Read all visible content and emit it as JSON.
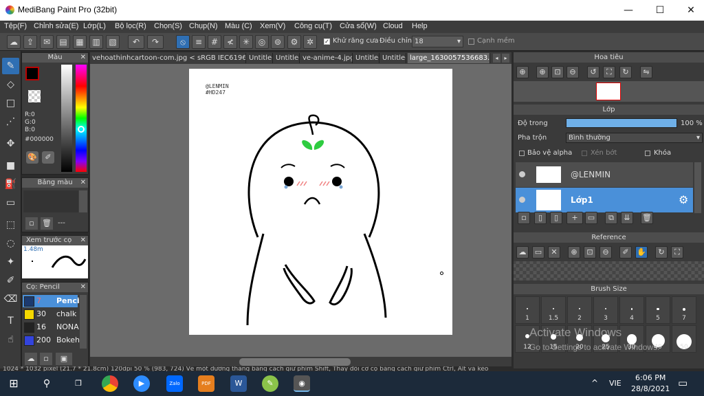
{
  "window": {
    "title": "MediBang Paint Pro (32bit)",
    "min_label": "—",
    "max_label": "☐",
    "close_label": "✕"
  },
  "menu": [
    "Tệp(F)",
    "Chỉnh sửa(E)",
    "Lớp(L)",
    "Bộ lọc(R)",
    "Chọn(S)",
    "Chụp(N)",
    "Màu (C)",
    "Xem(V)",
    "Công cụ(T)",
    "Cửa sổ(W)",
    "Cloud",
    "Help"
  ],
  "toolbar": {
    "antialias_label": "Khử răng cưa",
    "adjust_label": "Điều chỉnh",
    "adjust_value": "18",
    "snap_label": "Cạnh mềm"
  },
  "color_panel": {
    "title": "Màu",
    "r": "R:0",
    "g": "G:0",
    "b": "B:0",
    "hex": "#000000"
  },
  "palette_panel": {
    "title": "Bảng màu",
    "dashes": "---"
  },
  "preview_panel": {
    "title": "Xem trước cọ",
    "size": "1.48m"
  },
  "brush_panel": {
    "title": "Cọ: Pencil",
    "items": [
      {
        "size": "7",
        "name": "Pencil",
        "color": "#1c3a6e"
      },
      {
        "size": "30",
        "name": "chalk",
        "color": "#f5d800"
      },
      {
        "size": "16",
        "name": "NONA",
        "color": "#222222"
      },
      {
        "size": "200",
        "name": "Bokeh",
        "color": "#3344dd"
      }
    ]
  },
  "doc_tabs": [
    "vehoathinhcartoon-com.jpg < sRGB IEC61966-2.1 >",
    "Untitled",
    "Untitled",
    "ve-anime-4.jpg",
    "Untitled",
    "Untitled",
    "large_1630057536683.jpg"
  ],
  "canvas": {
    "signature_line1": "@LENMIN",
    "signature_line2": "#HD247"
  },
  "navigator": {
    "title": "Hoa tiêu"
  },
  "layers": {
    "title": "Lớp",
    "opacity_label": "Độ trong",
    "opacity_value": "100 %",
    "opacity_fraction": 1.0,
    "blend_label": "Pha trộn",
    "blend_value": "Bình thường",
    "protect_alpha": "Bảo vệ alpha",
    "clipping": "Xén bớt",
    "lock": "Khóa",
    "items": [
      {
        "name": "@LENMIN",
        "selected": false
      },
      {
        "name": "Lớp1",
        "selected": true
      }
    ]
  },
  "reference": {
    "title": "Reference"
  },
  "brush_size": {
    "title": "Brush Size",
    "sizes": [
      "1",
      "1.5",
      "2",
      "3",
      "4",
      "5",
      "7",
      "12",
      "15",
      "20",
      "25",
      "30",
      "40",
      "50"
    ]
  },
  "watermark": {
    "line1": "Activate Windows",
    "line2": "Go to Settings to activate Windows."
  },
  "status_text": "1024 * 1032 pixel  (21.7 * 21.8cm)  120dpi  50 %  (983, 724)  Vẽ một đường thẳng bằng cách giữ phím Shift, Thay đổi cỡ cọ bằng cách giữ phím Ctrl, Alt và kéo",
  "taskbar": {
    "lang": "VIE",
    "time": "6:06 PM",
    "date": "28/8/2021",
    "caret": "^"
  },
  "colors": {
    "accent": "#2f6fb3",
    "layer_selected": "#4a90d9",
    "leaf": "#2ecc40"
  }
}
